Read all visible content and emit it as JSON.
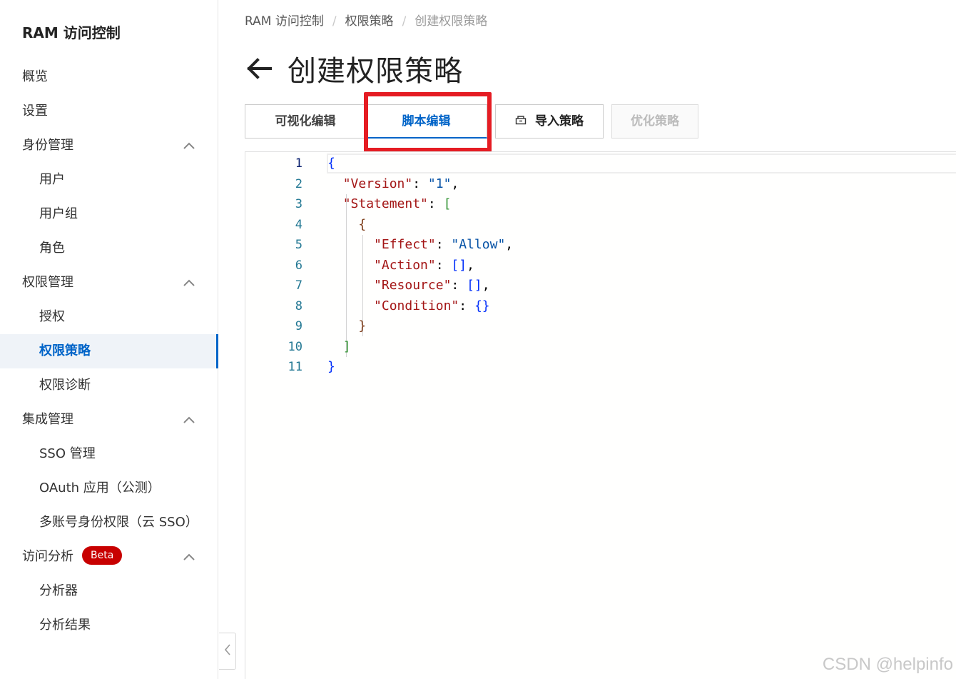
{
  "sidebar": {
    "title": "RAM 访问控制",
    "items": [
      {
        "label": "概览"
      },
      {
        "label": "设置"
      },
      {
        "label": "身份管理"
      },
      {
        "label": "用户"
      },
      {
        "label": "用户组"
      },
      {
        "label": "角色"
      },
      {
        "label": "权限管理"
      },
      {
        "label": "授权"
      },
      {
        "label": "权限策略"
      },
      {
        "label": "权限诊断"
      },
      {
        "label": "集成管理"
      },
      {
        "label": "SSO 管理"
      },
      {
        "label": "OAuth 应用（公测）"
      },
      {
        "label": "多账号身份权限（云 SSO）"
      },
      {
        "label": "访问分析",
        "badge": "Beta"
      },
      {
        "label": "分析器"
      },
      {
        "label": "分析结果"
      }
    ]
  },
  "breadcrumb": [
    "RAM 访问控制",
    "权限策略",
    "创建权限策略"
  ],
  "page_title": "创建权限策略",
  "tabs": {
    "visual": "可视化编辑",
    "script": "脚本编辑",
    "import": "导入策略",
    "optimize": "优化策略"
  },
  "editor": {
    "line_numbers": [
      "1",
      "2",
      "3",
      "4",
      "5",
      "6",
      "7",
      "8",
      "9",
      "10",
      "11"
    ],
    "keys": {
      "version": "\"Version\"",
      "version_value": "\"1\"",
      "statement": "\"Statement\"",
      "effect": "\"Effect\"",
      "effect_value": "\"Allow\"",
      "action": "\"Action\"",
      "resource": "\"Resource\"",
      "condition": "\"Condition\""
    }
  },
  "watermark": "CSDN @helpinfo",
  "colors": {
    "accent": "#0064c8",
    "highlight": "#e51c23",
    "badge": "#c80000"
  }
}
